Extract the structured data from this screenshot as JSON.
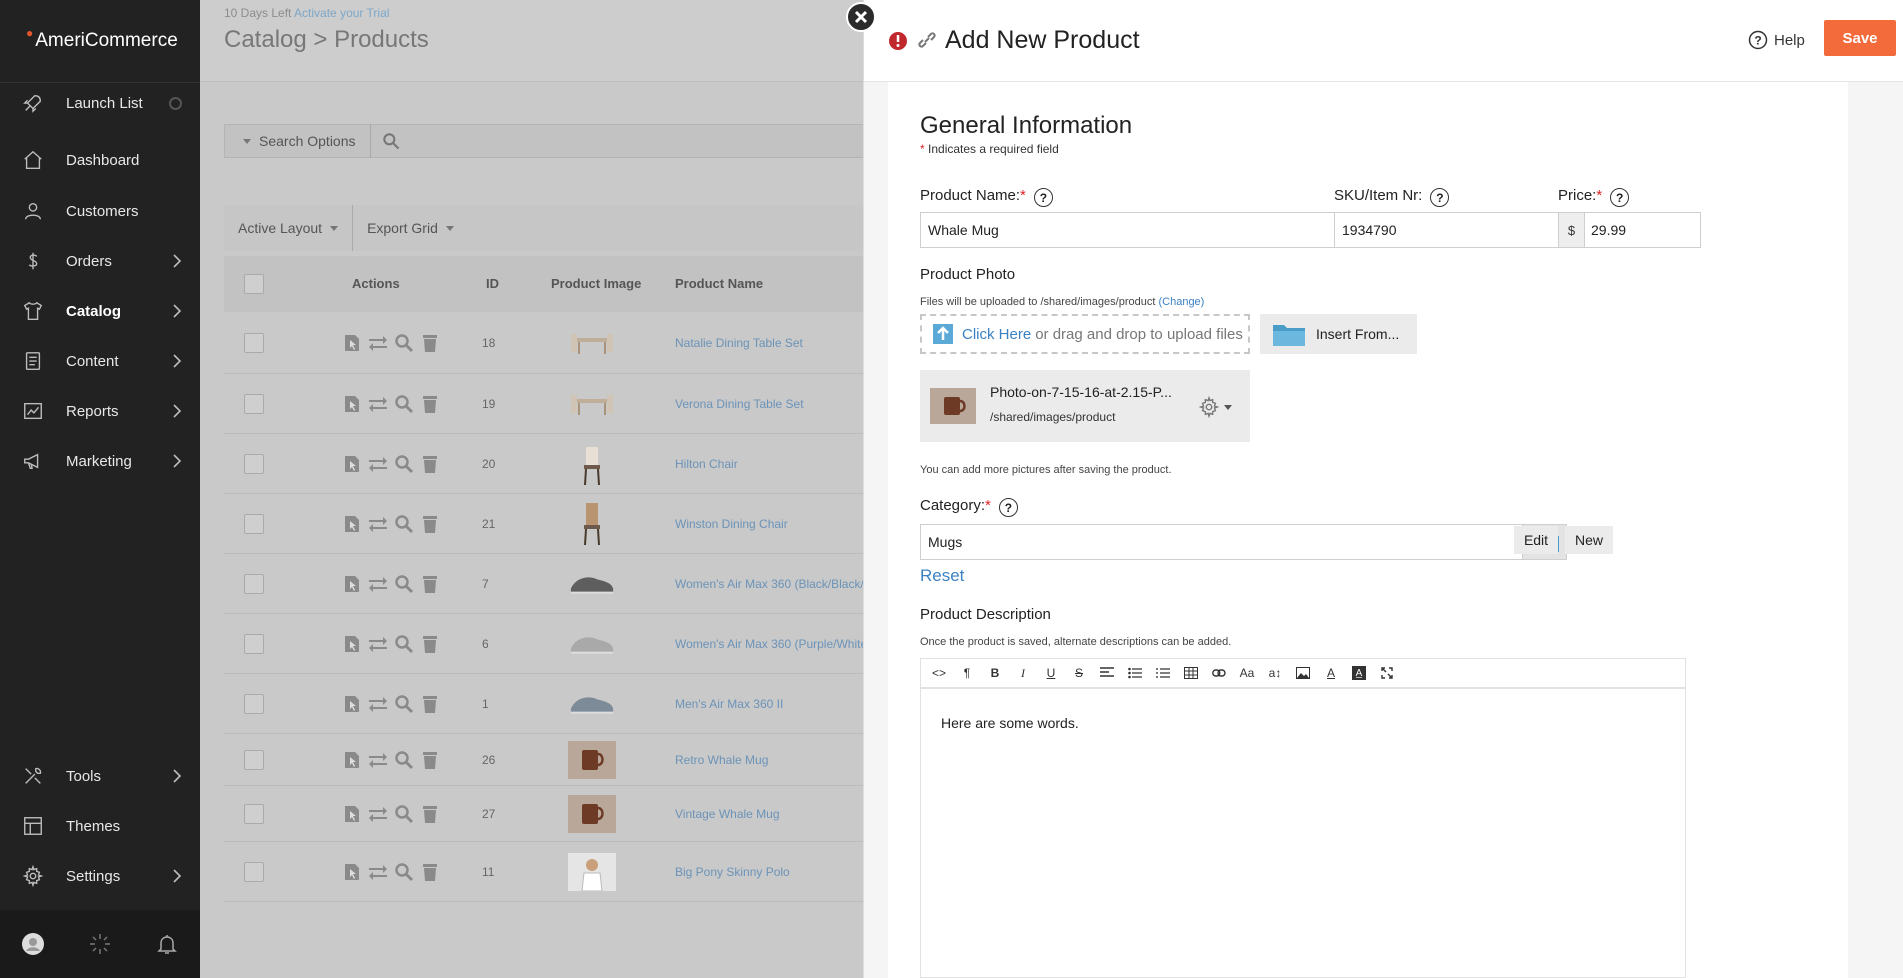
{
  "brand": {
    "name": "AmeriCommerce"
  },
  "sidebar": {
    "items": [
      {
        "label": "Launch List",
        "icon": "rocket-icon"
      },
      {
        "label": "Dashboard",
        "icon": "home-icon"
      },
      {
        "label": "Customers",
        "icon": "user-icon"
      },
      {
        "label": "Orders",
        "icon": "dollar-icon"
      },
      {
        "label": "Catalog",
        "icon": "shirt-icon"
      },
      {
        "label": "Content",
        "icon": "document-icon"
      },
      {
        "label": "Reports",
        "icon": "chart-icon"
      },
      {
        "label": "Marketing",
        "icon": "megaphone-icon"
      },
      {
        "label": "Tools",
        "icon": "tools-icon"
      },
      {
        "label": "Themes",
        "icon": "layout-icon"
      },
      {
        "label": "Settings",
        "icon": "gear-icon"
      }
    ]
  },
  "background": {
    "trial_text": "10 Days Left",
    "trial_link": "Activate your Trial",
    "title": "Catalog > Products",
    "search_options": "Search Options",
    "active_layout": "Active Layout",
    "export_grid": "Export Grid",
    "columns": {
      "actions": "Actions",
      "id": "ID",
      "image": "Product Image",
      "name": "Product Name"
    },
    "rows": [
      {
        "id": "18",
        "name": "Natalie Dining Table Set"
      },
      {
        "id": "19",
        "name": "Verona Dining Table Set"
      },
      {
        "id": "20",
        "name": "Hilton Chair"
      },
      {
        "id": "21",
        "name": "Winston Dining Chair"
      },
      {
        "id": "7",
        "name": "Women's Air Max 360 (Black/Black/S"
      },
      {
        "id": "6",
        "name": "Women's Air Max 360 (Purple/White"
      },
      {
        "id": "1",
        "name": "Men's Air Max 360 II"
      },
      {
        "id": "26",
        "name": "Retro Whale Mug"
      },
      {
        "id": "27",
        "name": "Vintage Whale Mug"
      },
      {
        "id": "11",
        "name": "Big Pony Skinny Polo"
      }
    ]
  },
  "panel": {
    "title": "Add New Product",
    "help": "Help",
    "save": "Save",
    "section_title": "General Information",
    "required_mark": "*",
    "required_note": "Indicates a required field",
    "product_name_label": "Product Name:",
    "product_name_value": "Whale Mug",
    "sku_label": "SKU/Item Nr:",
    "sku_value": "1934790",
    "price_label": "Price:",
    "currency": "$",
    "price_value": "29.99",
    "photo_label": "Product Photo",
    "upload_note": "Files will be uploaded to /shared/images/product",
    "change_link": "(Change)",
    "click_here": "Click Here",
    "drop_text": "or drag and drop to upload files",
    "insert_from": "Insert From...",
    "photo_file": "Photo-on-7-15-16-at-2.15-P...",
    "photo_path": "/shared/images/product",
    "more_pics_note": "You can add more pictures after saving the product.",
    "category_label": "Category:",
    "category_value": "Mugs",
    "edit": "Edit",
    "new": "New",
    "reset": "Reset",
    "description_label": "Product Description",
    "description_note": "Once the product is saved, alternate descriptions can be added.",
    "description_text": "Here are some words.",
    "toolbar": [
      "<>",
      "¶",
      "B",
      "I",
      "U",
      "S",
      "align",
      "ul",
      "ol",
      "table",
      "link",
      "Aa",
      "a↕",
      "image",
      "A",
      "A̲",
      "expand"
    ]
  }
}
